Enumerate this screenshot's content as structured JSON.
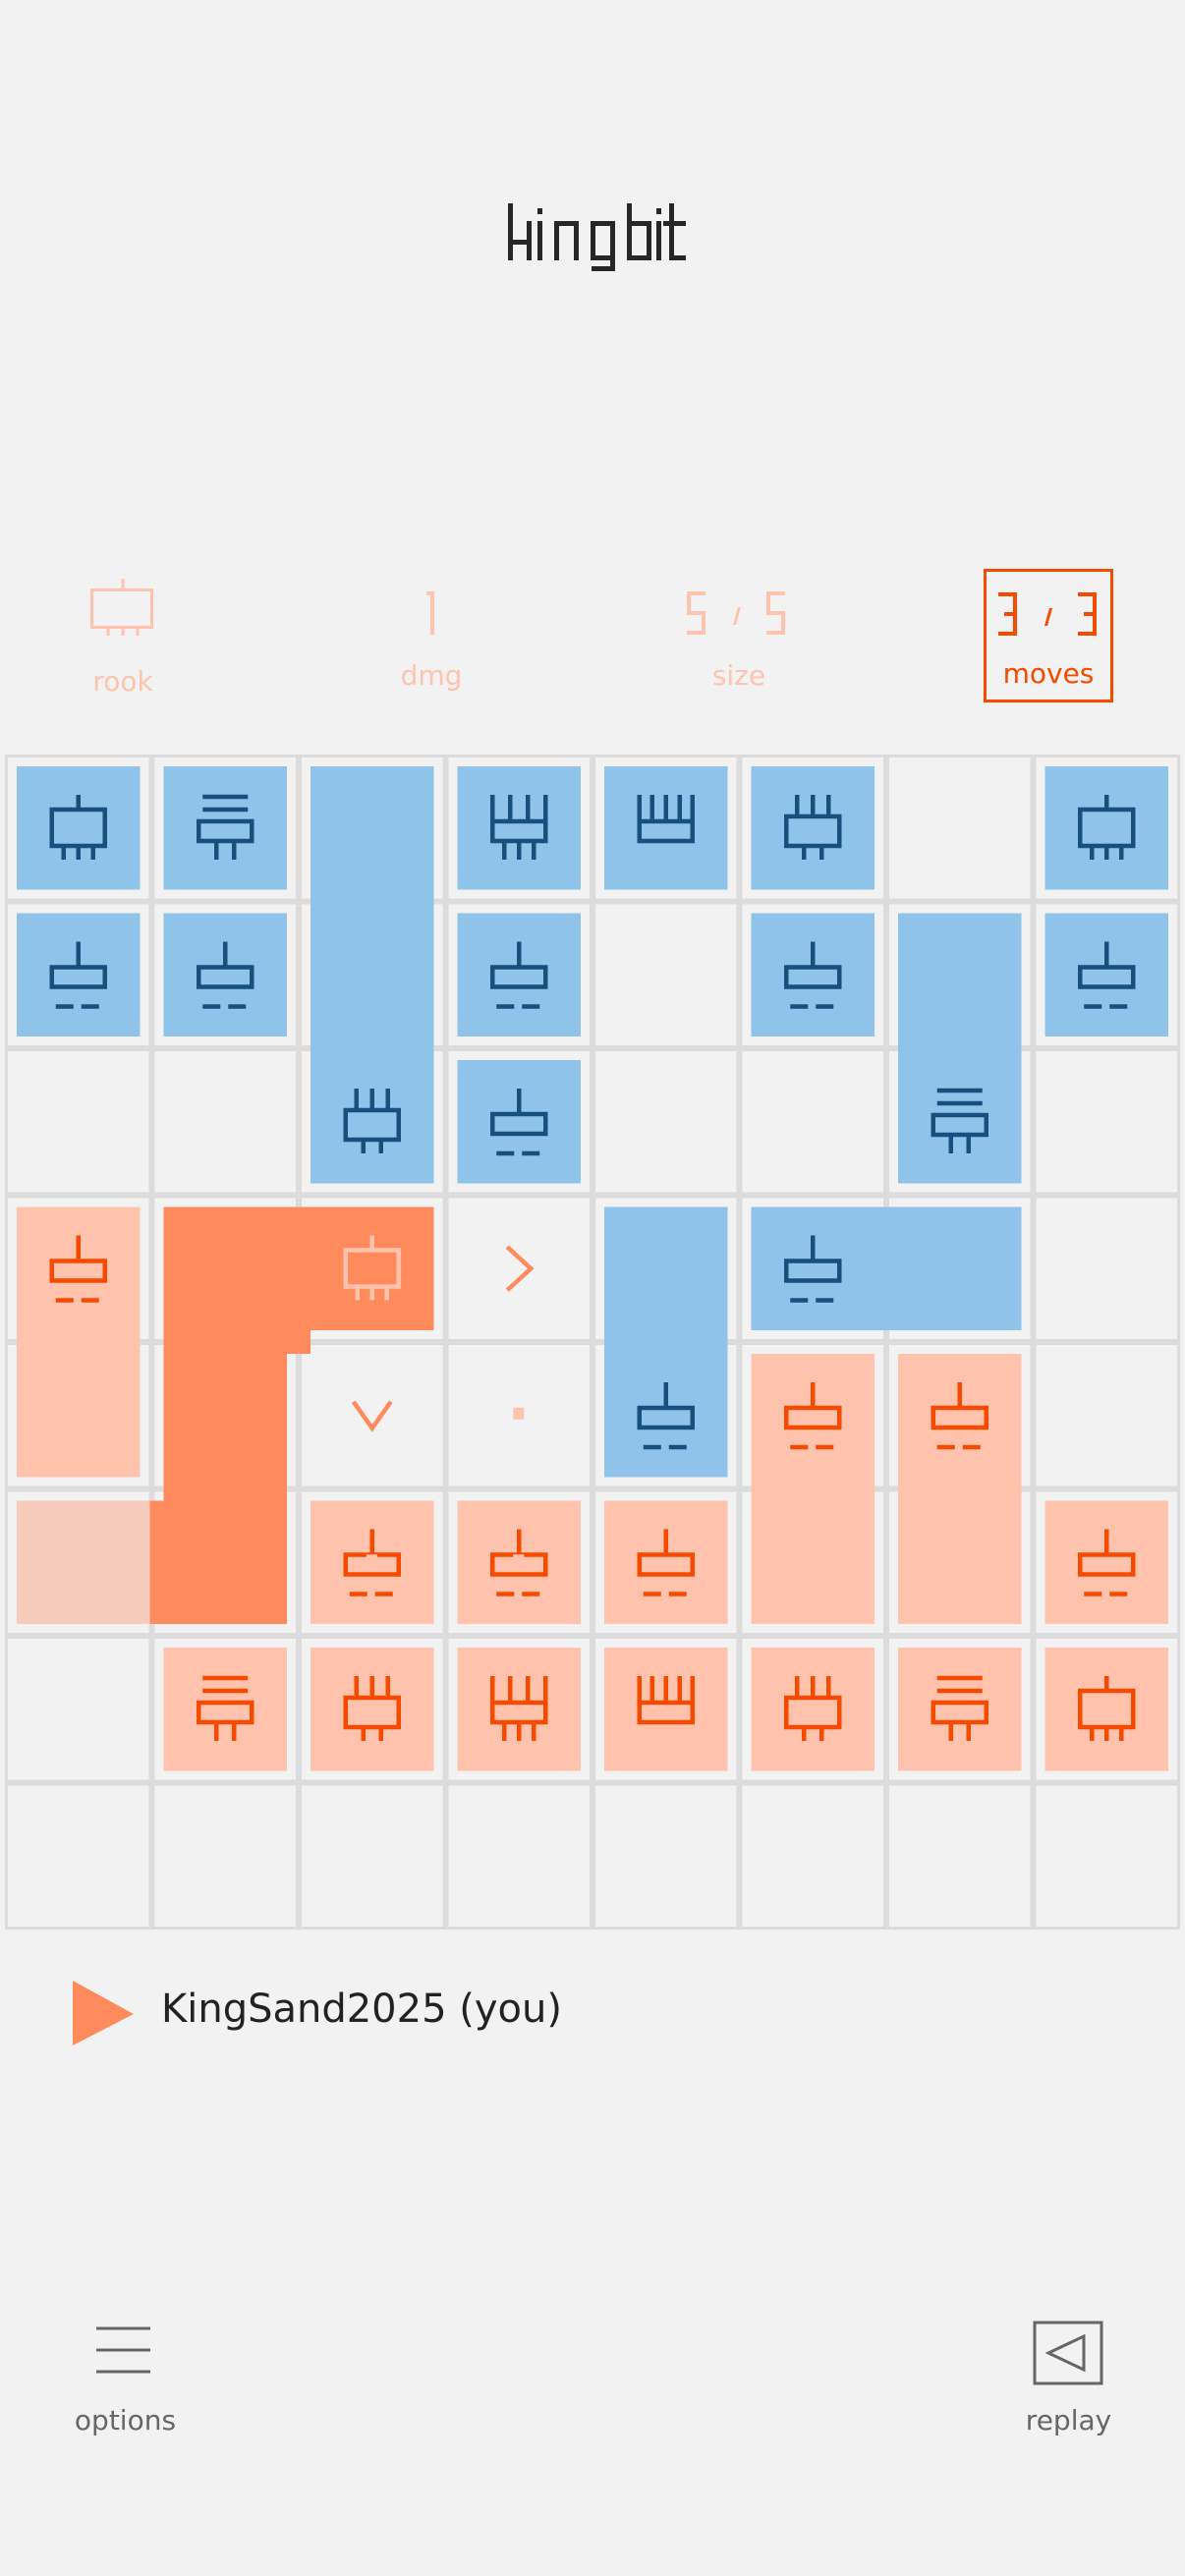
{
  "app": {
    "title": "kingbit"
  },
  "stats": {
    "piece": {
      "name": "rook",
      "icon": "king-piece-icon"
    },
    "dmg": {
      "value": "1",
      "label": "dmg"
    },
    "size": {
      "current": "5",
      "max": "5",
      "sep": "/",
      "label": "size"
    },
    "moves": {
      "current": "3",
      "max": "3",
      "sep": "/",
      "label": "moves"
    }
  },
  "colors": {
    "background": "#f2f2f2",
    "grid": "#dcdcdc",
    "blue_fill": "#8fc3ea",
    "blue_stroke": "#17507e",
    "peach_fill": "#ffc3ad",
    "orange_stroke": "#f54a00",
    "selected_fill": "#ff8a5c",
    "faded_fill": "#f7cbbb",
    "hint": "#ff8a5c",
    "text_dark": "#222222",
    "text_muted": "#666666"
  },
  "board": {
    "cols": 8,
    "rows": 8,
    "pieces": [
      {
        "team": "blue",
        "glyph": "king",
        "col": 0,
        "row": 0,
        "w": 1,
        "h": 1
      },
      {
        "team": "blue",
        "glyph": "queen",
        "col": 1,
        "row": 0,
        "w": 1,
        "h": 1
      },
      {
        "team": "blue",
        "glyph": "bishop",
        "col": 2,
        "row": 0,
        "w": 1,
        "h": 3,
        "icon_row": 2
      },
      {
        "team": "blue",
        "glyph": "comb",
        "col": 3,
        "row": 0,
        "w": 1,
        "h": 1
      },
      {
        "team": "blue",
        "glyph": "crown",
        "col": 4,
        "row": 0,
        "w": 1,
        "h": 1
      },
      {
        "team": "blue",
        "glyph": "bishop",
        "col": 5,
        "row": 0,
        "w": 1,
        "h": 1
      },
      {
        "team": "blue",
        "glyph": "king",
        "col": 7,
        "row": 0,
        "w": 1,
        "h": 1
      },
      {
        "team": "blue",
        "glyph": "pawn",
        "col": 0,
        "row": 1,
        "w": 1,
        "h": 1
      },
      {
        "team": "blue",
        "glyph": "pawn",
        "col": 1,
        "row": 1,
        "w": 1,
        "h": 1
      },
      {
        "team": "blue",
        "glyph": "pawn",
        "col": 3,
        "row": 1,
        "w": 1,
        "h": 1
      },
      {
        "team": "blue",
        "glyph": "pawn",
        "col": 5,
        "row": 1,
        "w": 1,
        "h": 1
      },
      {
        "team": "blue",
        "glyph": "queen",
        "col": 6,
        "row": 1,
        "w": 1,
        "h": 2,
        "icon_row": 1
      },
      {
        "team": "blue",
        "glyph": "pawn",
        "col": 7,
        "row": 1,
        "w": 1,
        "h": 1
      },
      {
        "team": "blue",
        "glyph": "pawn",
        "col": 3,
        "row": 2,
        "w": 1,
        "h": 1
      },
      {
        "team": "blue",
        "glyph": "pawn",
        "col": 4,
        "row": 3,
        "w": 1,
        "h": 2,
        "icon_row": 1
      },
      {
        "team": "blue",
        "glyph": "pawn",
        "col": 5,
        "row": 3,
        "w": 2,
        "h": 1
      },
      {
        "team": "orange",
        "glyph": "pawn",
        "col": 0,
        "row": 3,
        "w": 1,
        "h": 2
      },
      {
        "team": "orange",
        "glyph": "pawn",
        "col": 5,
        "row": 4,
        "w": 1,
        "h": 2
      },
      {
        "team": "orange",
        "glyph": "pawn",
        "col": 6,
        "row": 4,
        "w": 1,
        "h": 2
      },
      {
        "team": "orange",
        "glyph": "pawn",
        "col": 1,
        "row": 5,
        "w": 1,
        "h": 1
      },
      {
        "team": "orange",
        "glyph": "pawn",
        "col": 2,
        "row": 5,
        "w": 1,
        "h": 1
      },
      {
        "team": "orange",
        "glyph": "pawn",
        "col": 3,
        "row": 5,
        "w": 1,
        "h": 1
      },
      {
        "team": "orange",
        "glyph": "pawn",
        "col": 4,
        "row": 5,
        "w": 1,
        "h": 1
      },
      {
        "team": "orange",
        "glyph": "pawn",
        "col": 7,
        "row": 5,
        "w": 1,
        "h": 1
      },
      {
        "team": "orange",
        "glyph": "queen",
        "col": 1,
        "row": 6,
        "w": 1,
        "h": 1
      },
      {
        "team": "orange",
        "glyph": "bishop",
        "col": 2,
        "row": 6,
        "w": 1,
        "h": 1
      },
      {
        "team": "orange",
        "glyph": "comb",
        "col": 3,
        "row": 6,
        "w": 1,
        "h": 1
      },
      {
        "team": "orange",
        "glyph": "crown",
        "col": 4,
        "row": 6,
        "w": 1,
        "h": 1
      },
      {
        "team": "orange",
        "glyph": "bishop",
        "col": 5,
        "row": 6,
        "w": 1,
        "h": 1
      },
      {
        "team": "orange",
        "glyph": "queen",
        "col": 6,
        "row": 6,
        "w": 1,
        "h": 1
      },
      {
        "team": "orange",
        "glyph": "king",
        "col": 7,
        "row": 6,
        "w": 1,
        "h": 1
      }
    ],
    "selected_piece": {
      "team": "orange",
      "glyph": "king",
      "cells": [
        [
          1,
          3
        ],
        [
          2,
          3
        ],
        [
          1,
          4
        ],
        [
          1,
          5
        ]
      ],
      "icon_cell": [
        2,
        3
      ]
    },
    "faded_cells": [
      [
        0,
        5
      ]
    ],
    "move_hints": [
      {
        "col": 3,
        "row": 3,
        "type": "arrow-right"
      },
      {
        "col": 2,
        "row": 4,
        "type": "arrow-down"
      },
      {
        "col": 3,
        "row": 4,
        "type": "dot"
      },
      {
        "col": 2,
        "row": 5,
        "type": "dot"
      },
      {
        "col": 3,
        "row": 5,
        "type": "dot"
      }
    ]
  },
  "player": {
    "name": "KingSand2025 (you)",
    "turn_icon": "play-triangle-icon"
  },
  "footer": {
    "options": {
      "label": "options",
      "icon": "menu-icon"
    },
    "replay": {
      "label": "replay",
      "icon": "replay-icon"
    }
  }
}
